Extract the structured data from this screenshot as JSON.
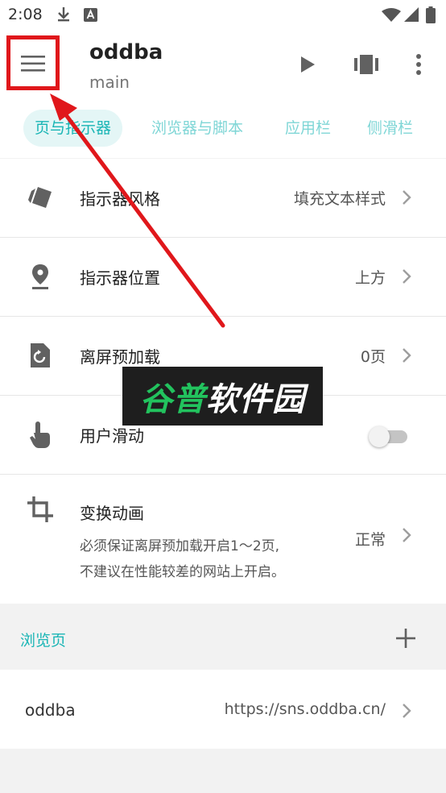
{
  "status_bar": {
    "time": "2:08"
  },
  "app_bar": {
    "title": "oddba",
    "subtitle": "main"
  },
  "tabs": [
    {
      "label": "页与指示器",
      "active": true
    },
    {
      "label": "浏览器与脚本",
      "active": false
    },
    {
      "label": "应用栏",
      "active": false
    },
    {
      "label": "侧滑栏",
      "active": false
    }
  ],
  "settings": {
    "indicator_style": {
      "label": "指示器风格",
      "value": "填充文本样式"
    },
    "indicator_position": {
      "label": "指示器位置",
      "value": "上方"
    },
    "offscreen_preload": {
      "label": "离屏预加载",
      "value": "0页"
    },
    "user_swipe": {
      "label": "用户滑动",
      "enabled": false
    },
    "transform_animation": {
      "label": "变换动画",
      "desc_line1": "必须保证离屏预加载开启1～2页,",
      "desc_line2": "不建议在性能较差的网站上开启。",
      "value": "正常"
    }
  },
  "section": {
    "title": "浏览页"
  },
  "page_item": {
    "name": "oddba",
    "url": "https://sns.oddba.cn/"
  },
  "watermark": {
    "part1": "谷普",
    "part2": "软件园"
  },
  "colors": {
    "accent": "#19b5b5",
    "annotation": "#e0171b"
  }
}
